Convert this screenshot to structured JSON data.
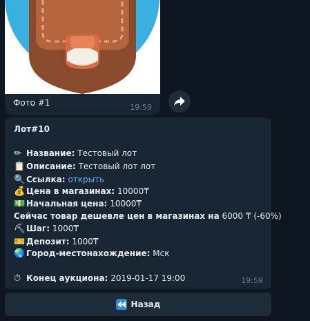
{
  "photo": {
    "caption": "Фото #1",
    "time": "19:59"
  },
  "message": {
    "title": "Лот#10",
    "name_label": "Название:",
    "name_value": "Тестовый лот",
    "desc_label": "Описание:",
    "desc_value": "Тестовый лот лот",
    "link_label": "Ссылка:",
    "link_value": "открыть",
    "store_price_label": "Цена в магазинах:",
    "store_price_value": "10000₸",
    "start_price_label": "Начальная цена:",
    "start_price_value": "10000₸",
    "cheaper_text": "Сейчас товар дешевле цен в магазинах на",
    "cheaper_value": "6000 ₸ (-60%)",
    "step_label": "Шаг:",
    "step_value": "1000₸",
    "deposit_label": "Депозит:",
    "deposit_value": "1000₸",
    "city_label": "Город-местонахождение:",
    "city_value": "Мск",
    "end_label": "Конец аукциона:",
    "end_value": "2019-01-17 19:00",
    "time": "19:59"
  },
  "keyboard": {
    "back_label": "Назад"
  },
  "icons": {
    "pencil": "pencil-icon",
    "clipboard": "clipboard-icon",
    "magnifier": "magnifier-icon",
    "money_bag": "money-bag-icon",
    "money": "money-icon",
    "pick": "pick-icon",
    "ticket": "ticket-icon",
    "globe": "globe-icon",
    "stopwatch": "stopwatch-icon",
    "rewind": "rewind-icon",
    "forward": "forward-arrow-icon"
  },
  "colors": {
    "background": "#0e1621",
    "bubble": "#182533",
    "link": "#6ab2f2",
    "accent": "#2f88d8"
  }
}
